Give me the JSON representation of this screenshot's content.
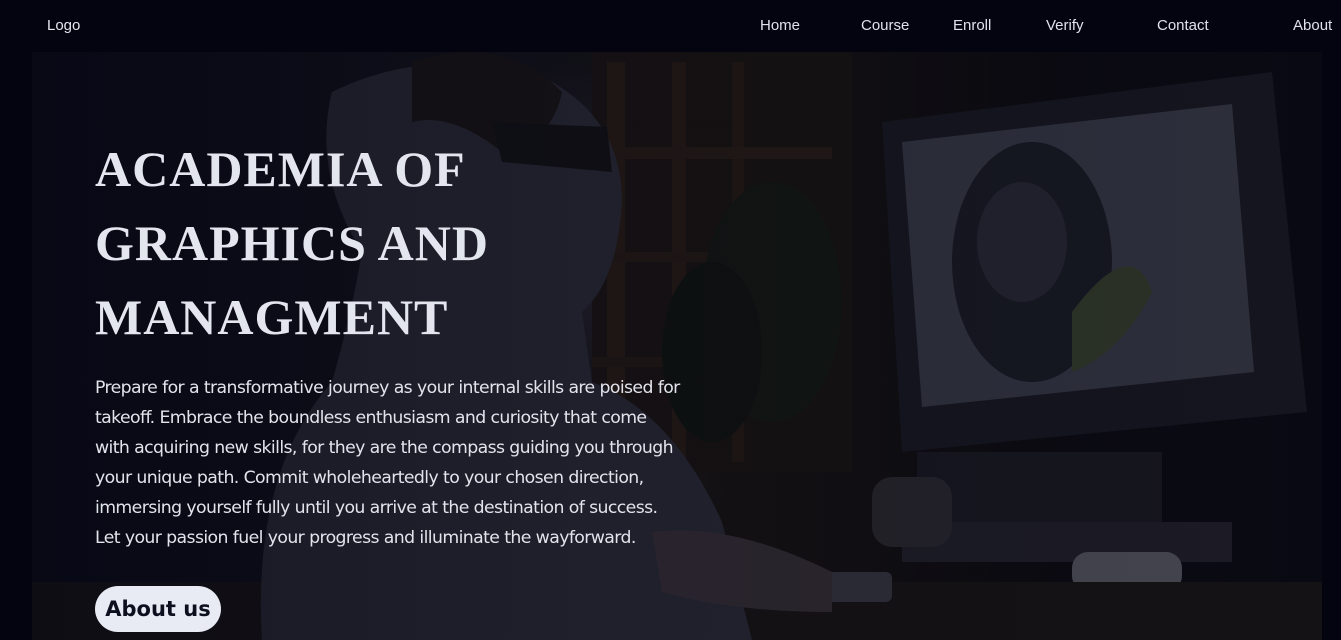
{
  "header": {
    "logo": "Logo",
    "nav": [
      {
        "label": "Home"
      },
      {
        "label": "Course"
      },
      {
        "label": "Enroll"
      },
      {
        "label": "Verify"
      },
      {
        "label": "Contact"
      },
      {
        "label": "About"
      }
    ]
  },
  "hero": {
    "title_lines": [
      "ACADEMIA OF",
      "GRAPHICS AND",
      "MANAGMENT"
    ],
    "description": "Prepare for a transformative journey as your internal skills are poised for takeoff. Embrace the boundless enthusiasm and curiosity that come with acquiring new skills, for they are the compass guiding you through your unique path. Commit wholeheartedly to your chosen direction, immersing yourself fully until you arrive at the destination of success. Let your passion fuel your progress and illuminate the wayforward.",
    "cta_label": "About us",
    "image_subject": "man-at-computer-photo"
  },
  "colors": {
    "background": "#03040f",
    "text": "#e4e6ef",
    "button_bg": "#e8ebf3",
    "button_text": "#0b0f1e"
  }
}
